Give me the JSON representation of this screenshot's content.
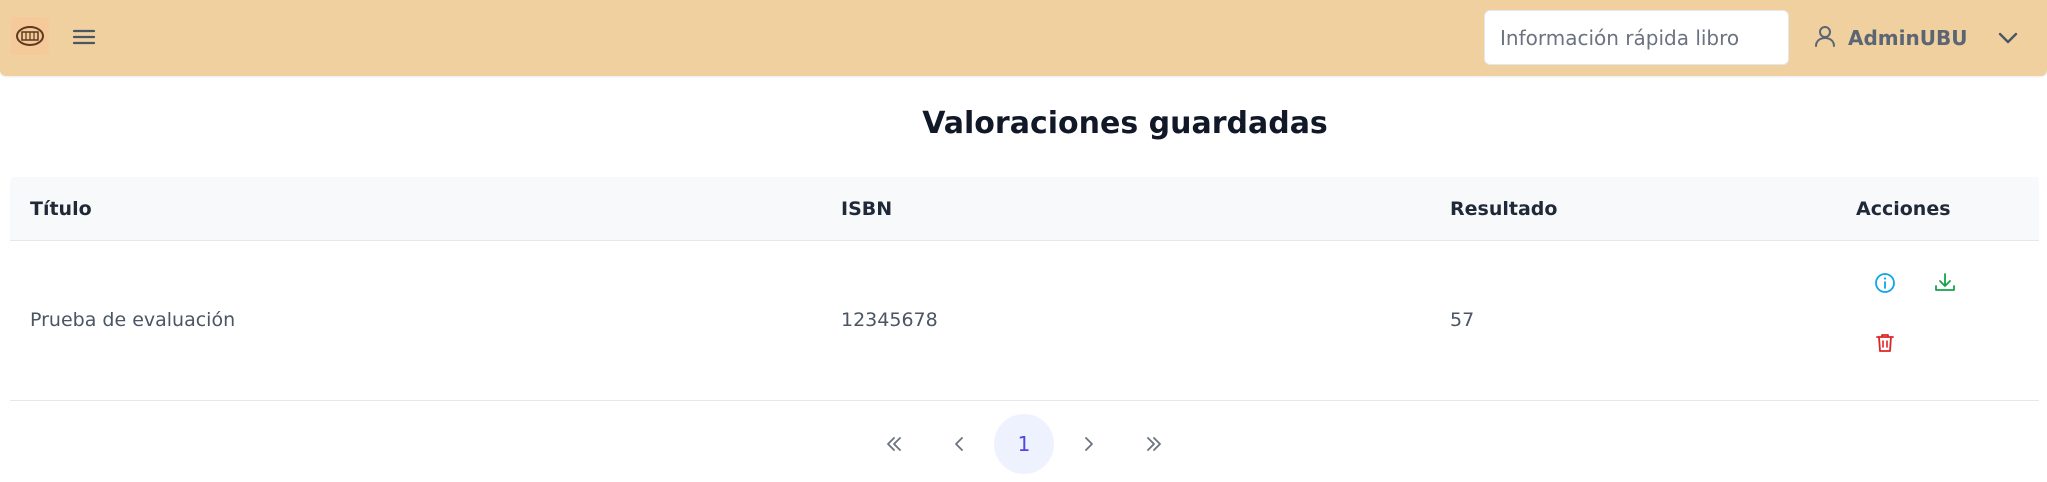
{
  "header": {
    "logo_icon": "library-logo-icon",
    "menu_icon": "hamburger-menu-icon",
    "search": {
      "placeholder": "Información rápida libro",
      "value": ""
    },
    "user": {
      "name": "AdminUBU",
      "icon": "user-icon",
      "dropdown_icon": "chevron-down-icon"
    }
  },
  "page": {
    "title": "Valoraciones guardadas"
  },
  "table": {
    "columns": [
      "Título",
      "ISBN",
      "Resultado",
      "Acciones"
    ],
    "rows": [
      {
        "titulo": "Prueba de evaluación",
        "isbn": "12345678",
        "resultado": "57",
        "actions": [
          "info-icon",
          "download-icon",
          "trash-icon"
        ]
      }
    ]
  },
  "pagination": {
    "current_page": "1",
    "first_icon": "chevrons-left-icon",
    "prev_icon": "chevron-left-icon",
    "next_icon": "chevron-right-icon",
    "last_icon": "chevrons-right-icon"
  },
  "colors": {
    "header_bg": "#efd09e",
    "info": "#0ea5e9",
    "download": "#16a34a",
    "delete": "#dc2626",
    "page_active": "#eef2ff"
  }
}
